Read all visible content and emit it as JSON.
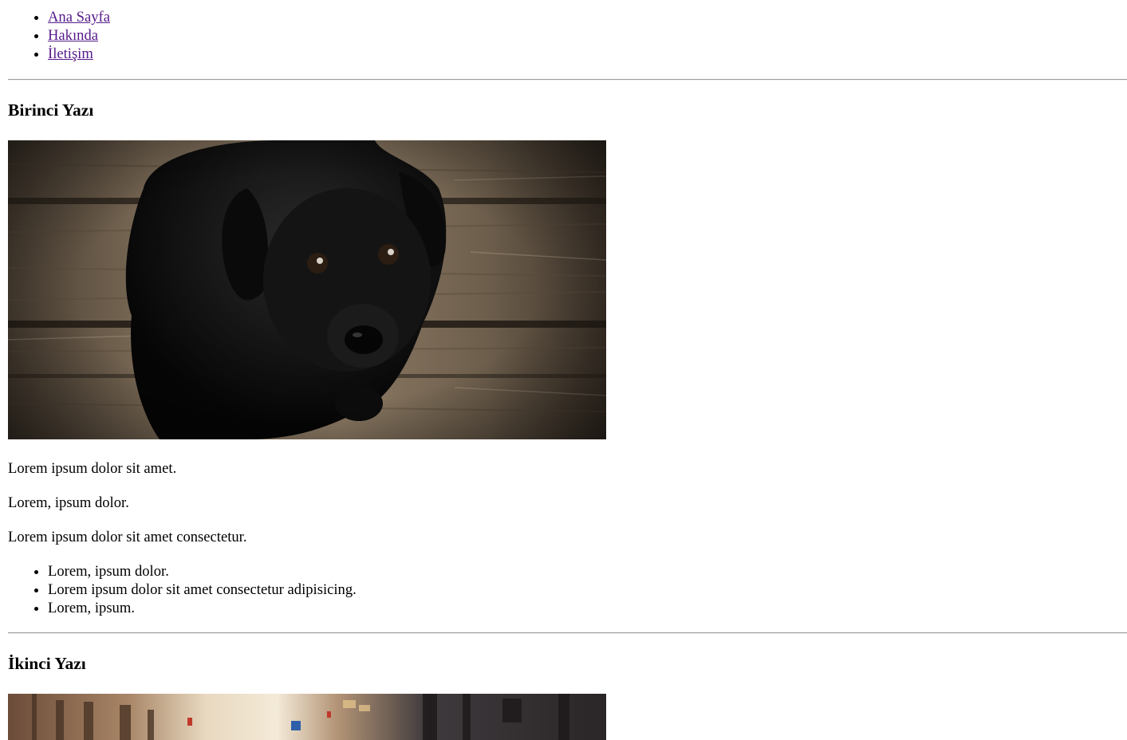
{
  "nav": {
    "items": [
      {
        "label": "Ana Sayfa"
      },
      {
        "label": "Hakında"
      },
      {
        "label": "İletişim"
      }
    ]
  },
  "posts": [
    {
      "title": "Birinci Yazı",
      "image_subject": "black-puppy-on-wooden-floor",
      "paragraphs": [
        "Lorem ipsum dolor sit amet.",
        "Lorem, ipsum dolor.",
        "Lorem ipsum dolor sit amet consectetur."
      ],
      "bullets": [
        "Lorem, ipsum dolor.",
        "Lorem ipsum dolor sit amet consectetur adipisicing.",
        "Lorem, ipsum."
      ]
    },
    {
      "title": "İkinci Yazı",
      "image_subject": "city-street-photo"
    }
  ],
  "colors": {
    "link_visited": "#551a8b",
    "divider": "#9a9a9a",
    "text": "#000000"
  }
}
